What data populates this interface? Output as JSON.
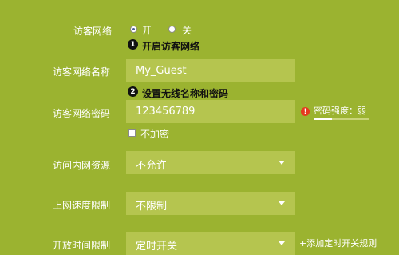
{
  "guest_network": {
    "label": "访客网络",
    "options": [
      "开",
      "关"
    ],
    "selected": "开"
  },
  "steps": {
    "step1": {
      "number": "1",
      "text": "开启访客网络"
    },
    "step2": {
      "number": "2",
      "text": "设置无线名称和密码"
    }
  },
  "guest_ssid": {
    "label": "访客网络名称",
    "value": "My_Guest"
  },
  "guest_password": {
    "label": "访客网络密码",
    "value": "123456789",
    "strength_label": "密码强度：弱",
    "strength_level": 0.33,
    "no_encryption_label": "不加密",
    "no_encryption_checked": false
  },
  "lan_access": {
    "label": "访问内网资源",
    "value": "不允许"
  },
  "speed_limit": {
    "label": "上网速度限制",
    "value": "不限制"
  },
  "time_limit": {
    "label": "开放时间限制",
    "value": "定时开关",
    "add_rule_label": "+添加定时开关规则"
  },
  "colors": {
    "background": "#9bb330",
    "field": "#b5c54f",
    "warning": "#e53a1f"
  }
}
